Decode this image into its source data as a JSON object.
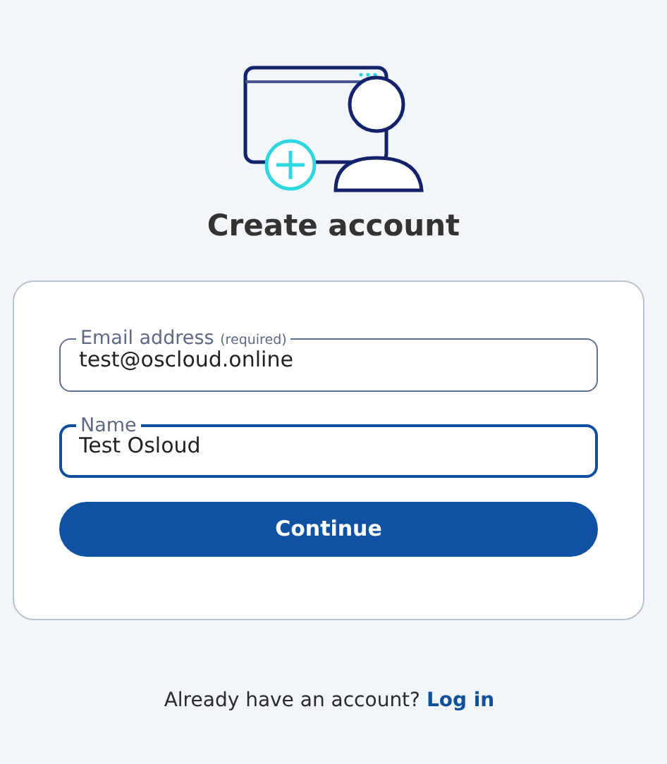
{
  "title": "Create account",
  "fields": [
    {
      "label": "Email address",
      "hint": "(required)",
      "value": "test@oscloud.online",
      "focused": false
    },
    {
      "label": "Name",
      "value": "Test Osloud",
      "focused": true
    }
  ],
  "button": "Continue",
  "footer": {
    "text": "Already have an account?",
    "link": "Log in"
  }
}
